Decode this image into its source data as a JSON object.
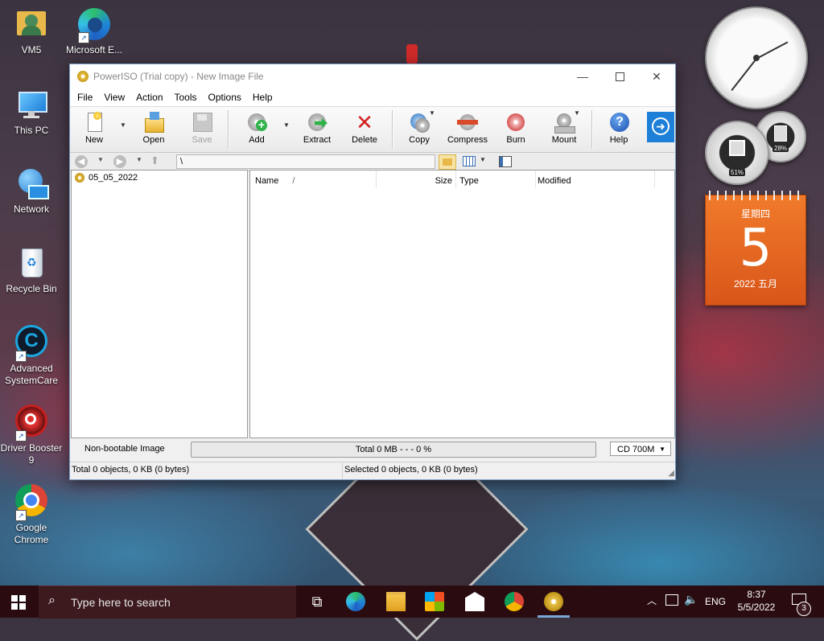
{
  "desktop": {
    "icons": [
      {
        "label": "VM5",
        "icon": "user-folder-icon"
      },
      {
        "label": "Microsoft\nE...",
        "icon": "edge-icon"
      },
      {
        "label": "This PC",
        "icon": "computer-icon"
      },
      {
        "label": "Network",
        "icon": "network-icon"
      },
      {
        "label": "Recycle Bin",
        "icon": "recycle-bin-icon"
      },
      {
        "label": "Advanced\nSystemCare",
        "icon": "advanced-systemcare-icon"
      },
      {
        "label": "Driver Booster\n9",
        "icon": "driver-booster-icon"
      },
      {
        "label": "Google\nChrome",
        "icon": "chrome-icon"
      }
    ]
  },
  "gadgets": {
    "cpu_percent": "51%",
    "mem_percent": "28%",
    "calendar": {
      "weekday": "星期四",
      "day": "5",
      "month_year": "2022 五月"
    }
  },
  "window": {
    "title": "PowerISO (Trial copy) - New Image File",
    "menu": [
      "File",
      "View",
      "Action",
      "Tools",
      "Options",
      "Help"
    ],
    "toolbar": {
      "new": "New",
      "open": "Open",
      "save": "Save",
      "add": "Add",
      "extract": "Extract",
      "delete": "Delete",
      "copy": "Copy",
      "compress": "Compress",
      "burn": "Burn",
      "mount": "Mount",
      "help": "Help"
    },
    "address_path": "\\",
    "tree_root": "05_05_2022",
    "columns": {
      "name": "Name",
      "sort_indicator": "/",
      "size": "Size",
      "type": "Type",
      "modified": "Modified"
    },
    "status": {
      "boot": "Non-bootable Image",
      "total_size": "Total  0 MB   - - -  0 %",
      "media": "CD 700M",
      "total_objects": "Total 0 objects, 0 KB (0 bytes)",
      "selected_objects": "Selected 0 objects, 0 KB (0 bytes)"
    }
  },
  "taskbar": {
    "search_placeholder": "Type here to search",
    "language": "ENG",
    "time": "8:37",
    "date": "5/5/2022",
    "notification_count": "3"
  }
}
